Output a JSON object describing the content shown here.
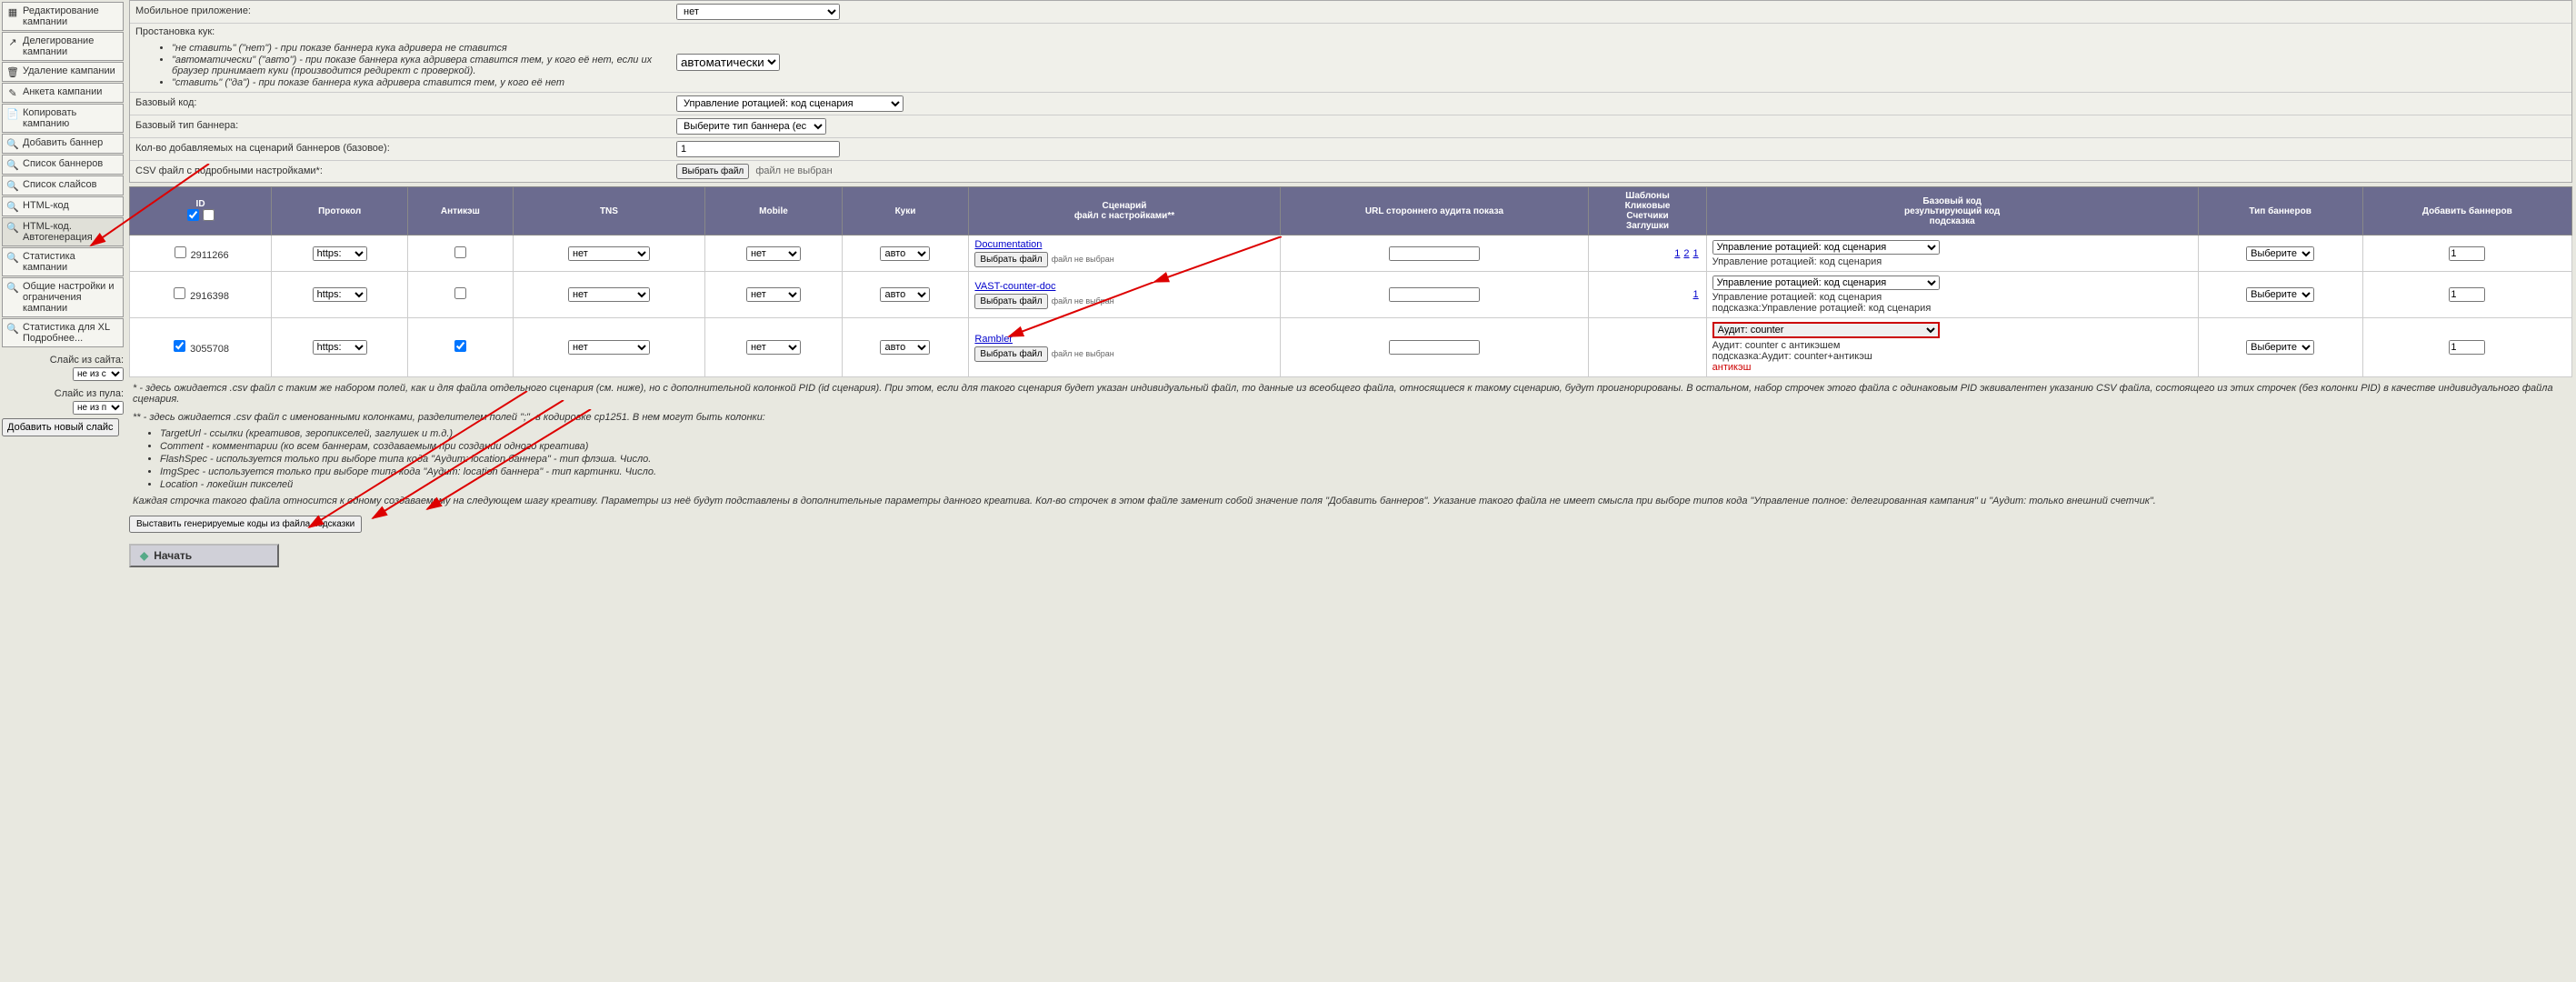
{
  "sidebar": {
    "items": [
      {
        "label": "Редактирование кампании",
        "icon": "grid"
      },
      {
        "label": "Делегирование кампании",
        "icon": "arrow"
      },
      {
        "label": "Удаление кампании",
        "icon": "trash"
      },
      {
        "label": "Анкета кампании",
        "icon": "pencil"
      },
      {
        "label": "Копировать кампанию",
        "icon": "copy"
      },
      {
        "label": "Добавить баннер",
        "icon": "search"
      },
      {
        "label": "Список баннеров",
        "icon": "search"
      },
      {
        "label": "Список слайсов",
        "icon": "search"
      },
      {
        "label": "HTML-код",
        "icon": "search"
      },
      {
        "label": "HTML-код. Автогенерация",
        "icon": "search",
        "active": true
      },
      {
        "label": "Статистика кампании",
        "icon": "search"
      },
      {
        "label": "Общие настройки и ограничения кампании",
        "icon": "search"
      },
      {
        "label": "Статистика для XL Подробнее...",
        "icon": "search"
      }
    ],
    "slice_site_label": "Слайс из сайта:",
    "slice_site_sel": "не из с",
    "slice_pool_label": "Слайс из пула:",
    "slice_pool_sel": "не из п",
    "add_slice_btn": "Добавить новый слайс"
  },
  "form": {
    "mobile_app_label": "Мобильное приложение:",
    "mobile_app_val": "нет",
    "cookies_label": "Простановка кук:",
    "cookies_desc": [
      "\"не ставить\" (\"нет\") - при показе баннера кука адривера не ставится",
      "\"автоматически\" (\"авто\") - при показе баннера кука адривера ставится тем, у кого её нет, если их браузер принимает куки (производится редирект с проверкой).",
      "\"ставить\" (\"да\") - при показе баннера кука адривера ставится тем, у кого её нет"
    ],
    "cookies_val": "автоматически",
    "base_code_label": "Базовый код:",
    "base_code_val": "Управление ротацией: код сценария",
    "base_type_label": "Базовый тип баннера:",
    "base_type_val": "Выберите тип баннера (ес",
    "count_label": "Кол-во добавляемых на сценарий баннеров (базовое):",
    "count_val": "1",
    "csv_label": "CSV файл с подробными настройками*:",
    "csv_btn": "Выбрать файл",
    "csv_status": "файл не выбран"
  },
  "table": {
    "headers": {
      "id": "ID",
      "protocol": "Протокол",
      "anticache": "Антикэш",
      "tns": "TNS",
      "mobile": "Mobile",
      "cookies": "Куки",
      "scenario": "Сценарий\nфайл с настройками**",
      "audit_url": "URL стороннего аудита показа",
      "templates": "Шаблоны\nКликовые\nСчетчики\nЗаглушки",
      "base_code": "Базовый код\nрезультирующий код\nподсказка",
      "banner_type": "Тип баннеров",
      "add_banners": "Добавить баннеров"
    },
    "rows": [
      {
        "checked": false,
        "id": "2911266",
        "protocol": "https:",
        "anticache": false,
        "tns": "нет",
        "mobile": "нет",
        "cookies": "авто",
        "scenario_link": "Documentation",
        "file_btn": "Выбрать файл",
        "file_status": "файл не выбран",
        "audit_url": "",
        "templates": [
          "1",
          "2",
          "1"
        ],
        "code_sel": "Управление ротацией: код сценария",
        "code_line1": "Управление ротацией: код сценария",
        "code_line2": "",
        "banner_type": "Выберите",
        "add_count": "1"
      },
      {
        "checked": false,
        "id": "2916398",
        "protocol": "https:",
        "anticache": false,
        "tns": "нет",
        "mobile": "нет",
        "cookies": "авто",
        "scenario_link": "VAST-counter-doc",
        "file_btn": "Выбрать файл",
        "file_status": "файл не выбран",
        "audit_url": "",
        "templates": [
          "1"
        ],
        "code_sel": "Управление ротацией: код сценария",
        "code_line1": "Управление ротацией: код сценария",
        "code_line2": "подсказка:Управление ротацией: код сценария",
        "banner_type": "Выберите",
        "add_count": "1"
      },
      {
        "checked": true,
        "id": "3055708",
        "protocol": "https:",
        "anticache": true,
        "tns": "нет",
        "mobile": "нет",
        "cookies": "авто",
        "scenario_link": "Rambler",
        "file_btn": "Выбрать файл",
        "file_status": "файл не выбран",
        "audit_url": "",
        "templates": [],
        "code_sel": "Аудит: counter",
        "code_line1": "Аудит: counter с антикэшем",
        "code_line2": "подсказка:Аудит: counter+антикэш",
        "code_line3": "антикэш",
        "banner_type": "Выберите",
        "add_count": "1",
        "highlight": true
      }
    ]
  },
  "notes": {
    "star1": "* - здесь ожидается .csv файл с таким же набором полей, как и для файла отдельного сценария (см. ниже), но с дополнительной колонкой PID (id сценария). При этом, если для такого сценария будет указан индивидуальный файл, то данные из всеобщего файла, относящиеся к такому сценарию, будут проигнорированы. В остальном, набор строчек этого файла с одинаковым PID эквивалентен указанию CSV файла, состоящего из этих строчек (без колонки PID) в качестве индивидуального файла сценария.",
    "star2_intro": "** - здесь ожидается .csv файл с именованными колонками, разделителем полей \";\", в кодировке cp1251. В нем могут быть колонки:",
    "star2_items": [
      "TargetUrl - ссылки (креативов, зеропикселей, заглушек и т.д.)",
      "Comment - комментарии (ко всем баннерам, создаваемым при создании одного креатива)",
      "FlashSpec - используется только при выборе типа кода \"Аудит: location баннера\" - тип флэша. Число.",
      "ImgSpec - используется только при выборе типа кода \"Аудит: location баннера\" - тип картинки. Число.",
      "Location - локейшн пикселей"
    ],
    "star2_outro": "Каждая строчка такого файла относится к одному создаваемому на следующем шагу креативу. Параметры из неё будут подставлены в дополнительные параметры данного креатива. Кол-во строчек в этом файле заменит собой значение поля \"Добавить баннеров\". Указание такого файла не имеет смысла при выборе типов кода \"Управление полное: делегированная кампания\" и \"Аудит: только внешний счетчик\".",
    "gen_btn": "Выставить генерируемые коды из файла подсказки",
    "start_btn": "Начать"
  }
}
